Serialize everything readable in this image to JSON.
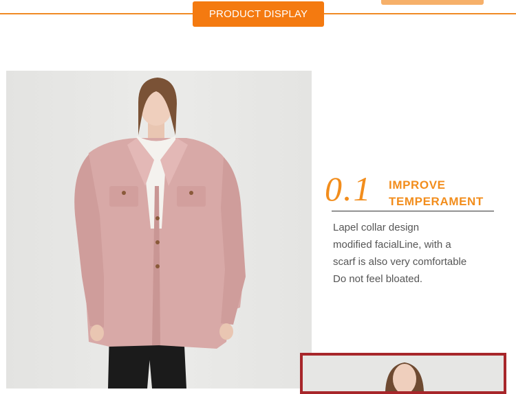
{
  "header": {
    "badge_label": "PRODUCT DISPLAY"
  },
  "feature": {
    "number": "0.1",
    "title_lines": [
      "IMPROVE",
      "TEMPERAMENT"
    ],
    "description_lines": [
      "Lapel collar design",
      "modified facialLine, with a",
      "scarf is also very comfortable",
      "Do not feel bloated."
    ]
  },
  "colors": {
    "accent": "#f28d1c",
    "badge": "#f47a10",
    "coat": "#d9a9a7",
    "frame": "#a7262a"
  }
}
